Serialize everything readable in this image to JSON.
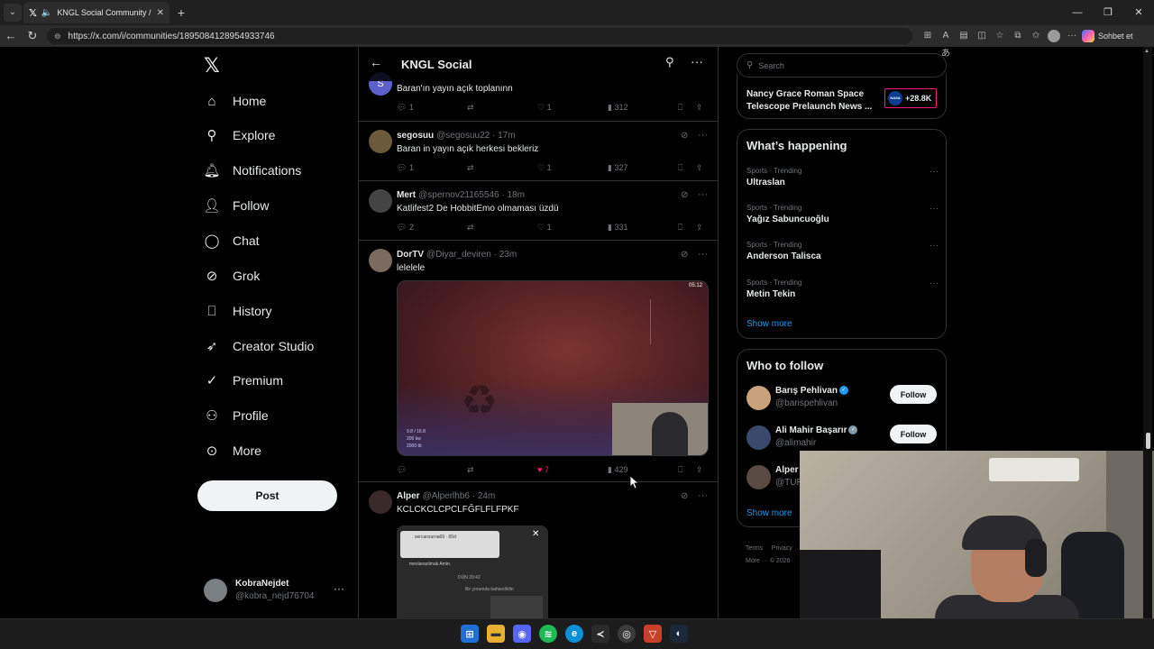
{
  "browser": {
    "tab_title": "KNGL Social Community / X",
    "url": "https://x.com/i/communities/1895084128954933746",
    "copilot_label": "Sohbet et"
  },
  "nav": {
    "items": [
      {
        "label": "Home",
        "icon": "home-icon"
      },
      {
        "label": "Explore",
        "icon": "search-icon"
      },
      {
        "label": "Notifications",
        "icon": "bell-icon"
      },
      {
        "label": "Follow",
        "icon": "person-add-icon"
      },
      {
        "label": "Chat",
        "icon": "chat-icon"
      },
      {
        "label": "Grok",
        "icon": "grok-icon"
      },
      {
        "label": "History",
        "icon": "bookmark-icon"
      },
      {
        "label": "Creator Studio",
        "icon": "rocket-icon"
      },
      {
        "label": "Premium",
        "icon": "verified-icon"
      },
      {
        "label": "Profile",
        "icon": "person-icon"
      },
      {
        "label": "More",
        "icon": "more-circle-icon"
      }
    ],
    "post_label": "Post",
    "account": {
      "name": "KobraNejdet",
      "handle": "@kobra_nejd76704"
    }
  },
  "main": {
    "title": "KNGL Social",
    "tweets": [
      {
        "name": "",
        "handle": "",
        "time": "",
        "text": "Baran'ın yayın açık toplanınn",
        "replies": "1",
        "reposts": "",
        "likes": "1",
        "views": "312",
        "avatar_color": "#5b61c9",
        "avatar_letter": "S"
      },
      {
        "name": "segosuu",
        "handle": "@segosuu22 · 17m",
        "text": "Baran in yayın açık herkesi bekleriz",
        "replies": "1",
        "reposts": "",
        "likes": "1",
        "views": "327",
        "avatar_color": "#6b5a3c"
      },
      {
        "name": "Mert",
        "handle": "@spernov21165546 · 18m",
        "text": "Katlifest2 De HobbitEmo olmaması üzdü",
        "replies": "2",
        "reposts": "",
        "likes": "1",
        "views": "331",
        "avatar_color": "#444"
      },
      {
        "name": "DorTV",
        "handle": "@Diyar_deviren · 23m",
        "text": "lelelele",
        "replies": "",
        "reposts": "",
        "likes": "7",
        "views": "429",
        "avatar_color": "#7b6a5e",
        "video_timer": "05:12",
        "video_stats": [
          "9.8 / 16.8",
          "200 kw",
          "2000 tb"
        ]
      },
      {
        "name": "Alper",
        "handle": "@Alperlhb6 · 24m",
        "text": "KCLCKCLCPCLFĞFLFLFPKF",
        "avatar_color": "#3b2a2a",
        "image_texts": {
          "card": "sercanzurna69 · 65d",
          "line1": "mevlanaolmak  Amin.",
          "line2": "DÜN 20:42",
          "line3": "Bir yorumda bahsedildin"
        }
      }
    ]
  },
  "right": {
    "search_placeholder": "Search",
    "live": {
      "title": "Nancy Grace Roman Space Telescope Prelaunch News ...",
      "count": "+28.8K",
      "badge": "NASA"
    },
    "whats_happening": {
      "title": "What’s happening",
      "trends": [
        {
          "category": "Sports · Trending",
          "name": "Ultraslan"
        },
        {
          "category": "Sports · Trending",
          "name": "Yağız Sabuncuoğlu"
        },
        {
          "category": "Sports · Trending",
          "name": "Anderson Talisca"
        },
        {
          "category": "Sports · Trending",
          "name": "Metin Tekin"
        }
      ],
      "show_more": "Show more"
    },
    "who_to_follow": {
      "title": "Who to follow",
      "users": [
        {
          "name": "Barış Pehlivan",
          "handle": "@barispehlivan",
          "follow": "Follow",
          "avatar_color": "#c9a27c"
        },
        {
          "name": "Ali Mahir Başarır",
          "handle": "@alimahir",
          "follow": "Follow",
          "avatar_color": "#3a4a6a"
        },
        {
          "name": "Alper",
          "handle": "@TUR",
          "follow": "",
          "avatar_color": "#5a4a44"
        }
      ],
      "show_more": "Show more"
    },
    "footer": {
      "terms": "Terms",
      "privacy": "Privacy",
      "more": "More ··· © 2026"
    }
  },
  "colors": {
    "accent": "#1d9bf0",
    "like": "#f91880",
    "bg": "#000000",
    "border": "#2f3336"
  }
}
